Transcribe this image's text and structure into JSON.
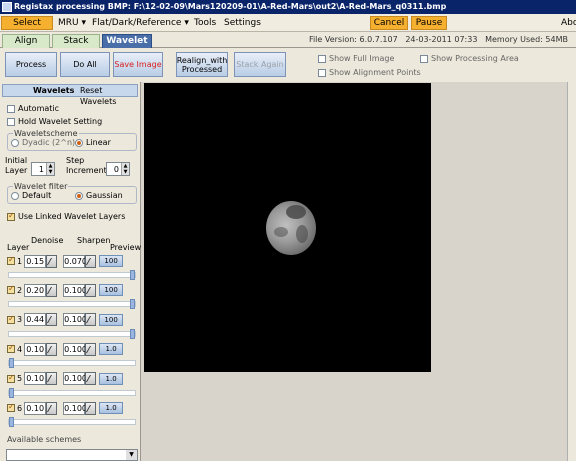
{
  "window": {
    "title": "Registax processing BMP: F:\\12-02-09\\Mars120209-01\\A-Red-Mars\\out2\\A-Red-Mars_q0311.bmp"
  },
  "menu": {
    "select": "Select",
    "mru": "MRU ▾",
    "flat": "Flat/Dark/Reference ▾",
    "tools": "Tools",
    "settings": "Settings",
    "cancel": "Cancel",
    "pause": "Pause",
    "about": "Abo"
  },
  "tabs": [
    {
      "label": "Align"
    },
    {
      "label": "Stack"
    },
    {
      "label": "Wavelet"
    }
  ],
  "fileinfo": {
    "version": "File Version: 6.0.7.107",
    "date": "24-03-2011 07:33",
    "memory": "Memory Used: 54MB"
  },
  "toolbar": {
    "process": "Process",
    "doall": "Do All",
    "saveimage": "Save Image",
    "realign": "Realign_with Processed",
    "stackagain": "Stack Again",
    "showfull": "Show Full Image",
    "showalign": "Show Alignment Points",
    "showprocessing": "Show Processing Area"
  },
  "panel": {
    "tab_wavelets": "Wavelets",
    "tab_reset": "Reset Wavelets",
    "automatic": "Automatic",
    "hold": "Hold Wavelet Setting",
    "scheme_legend": "Waveletscheme",
    "dyadic": "Dyadic (2^n)",
    "linear": "Linear",
    "initial_label": "Initial Layer",
    "initial_val": "1",
    "step_label": "Step Increment",
    "step_val": "0",
    "filter_legend": "Wavelet filter",
    "default": "Default",
    "gaussian": "Gaussian",
    "linked": "Use Linked Wavelet Layers",
    "col_layer": "Layer",
    "col_denoise": "Denoise",
    "col_sharpen": "Sharpen",
    "col_preview": "Preview",
    "available": "Available schemes"
  },
  "layers": [
    {
      "num": "1",
      "denoise": "0.15",
      "sharpen": "0.070",
      "preview": "100",
      "slider": 1.0
    },
    {
      "num": "2",
      "denoise": "0.20",
      "sharpen": "0.100",
      "preview": "100",
      "slider": 1.0
    },
    {
      "num": "3",
      "denoise": "0.44",
      "sharpen": "0.100",
      "preview": "100",
      "slider": 1.0
    },
    {
      "num": "4",
      "denoise": "0.10",
      "sharpen": "0.100",
      "preview": "1.0",
      "slider": 0.0
    },
    {
      "num": "5",
      "denoise": "0.10",
      "sharpen": "0.100",
      "preview": "1.0",
      "slider": 0.0
    },
    {
      "num": "6",
      "denoise": "0.10",
      "sharpen": "0.100",
      "preview": "1.0",
      "slider": 0.0
    }
  ]
}
